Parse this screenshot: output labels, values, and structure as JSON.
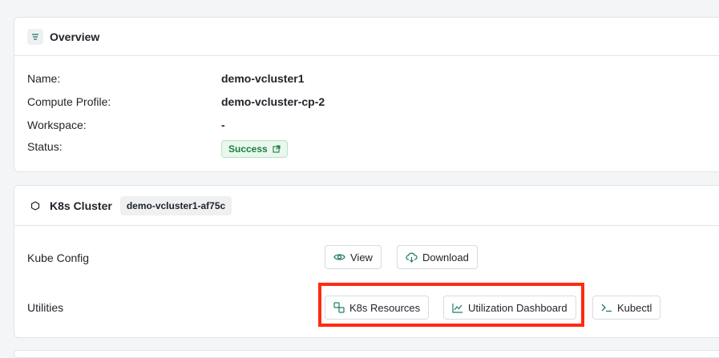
{
  "overview": {
    "title": "Overview",
    "icon": "list-icon",
    "fields": [
      {
        "label": "Name:",
        "value": "demo-vcluster1"
      },
      {
        "label": "Compute Profile:",
        "value": "demo-vcluster-cp-2"
      },
      {
        "label": "Workspace:",
        "value": "-"
      },
      {
        "label": "Status:",
        "value": "Success"
      }
    ]
  },
  "cluster": {
    "title": "K8s Cluster",
    "icon": "hexagon-icon",
    "cluster_name": "demo-vcluster1-af75c",
    "kube_config_label": "Kube Config",
    "view_label": "View",
    "download_label": "Download",
    "utilities_label": "Utilities",
    "k8s_resources_label": "K8s Resources",
    "utilization_label": "Utilization Dashboard",
    "kubectl_label": "Kubectl"
  },
  "colors": {
    "success": "#1a7f3c",
    "highlight": "#ff2a12",
    "icon_accent": "#1f7a6b"
  }
}
